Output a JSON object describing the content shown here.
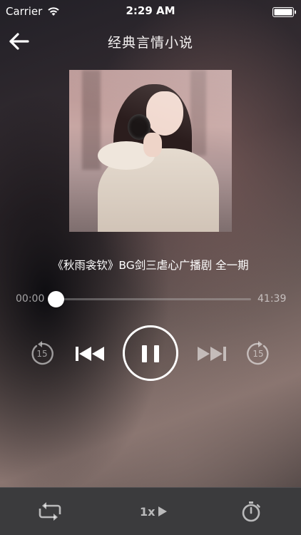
{
  "status_bar": {
    "carrier": "Carrier",
    "time": "2:29 AM"
  },
  "nav": {
    "title": "经典言情小说"
  },
  "track": {
    "title": "《秋雨衾钦》BG剑三虐心广播剧 全一期"
  },
  "progress": {
    "elapsed": "00:00",
    "total": "41:39",
    "fraction": 0.03
  },
  "controls": {
    "rewind_seconds": "15",
    "forward_seconds": "15"
  },
  "bottom_bar": {
    "speed_label": "1x"
  },
  "colors": {
    "bottom_bar_bg": "#3b3b3d",
    "accent": "#ffffff"
  },
  "icons": [
    "wifi-icon",
    "battery-icon",
    "back-arrow-icon",
    "rewind-15-icon",
    "previous-track-icon",
    "pause-icon",
    "next-track-icon",
    "forward-15-icon",
    "repeat-icon",
    "speed-play-icon",
    "timer-icon"
  ]
}
